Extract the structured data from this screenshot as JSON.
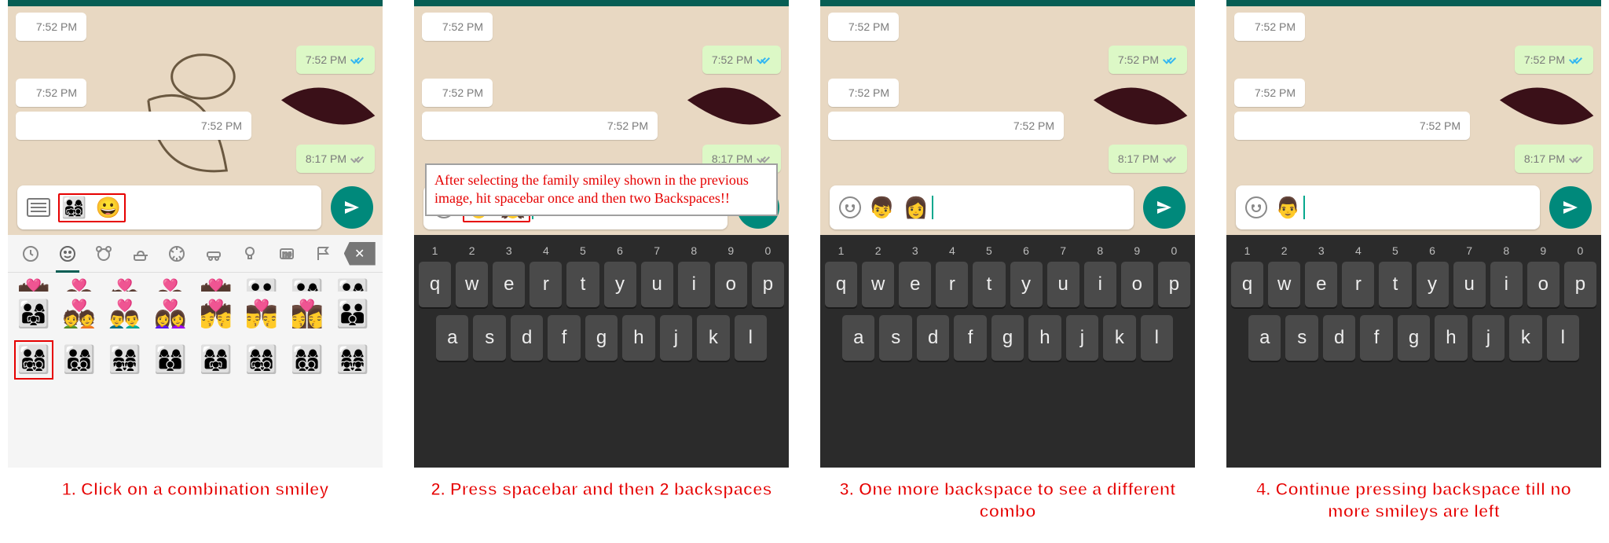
{
  "messages": {
    "t1": "7:52 PM",
    "t2": "7:52 PM",
    "t3": "7:52 PM",
    "t4": "7:52 PM",
    "t5": "8:17 PM"
  },
  "input": {
    "p1_emoji": "👨‍👩‍👧‍👦 😀",
    "p2_emoji": "👦 👧",
    "p3_emoji": "👦 👩",
    "p4_emoji": "👨"
  },
  "annotation": {
    "p2_overlay": "After selecting the family smiley shown in the previous image, hit spacebar once and then two Backspaces!!"
  },
  "emoji_picker": {
    "categories": [
      "recent",
      "smiley",
      "bear",
      "cup",
      "ball",
      "car",
      "bulb",
      "sym",
      "flag",
      "backspace"
    ],
    "row2": [
      "👨‍👩‍👧",
      "💑",
      "👨‍❤️‍👨",
      "👩‍❤️‍👩",
      "💏",
      "👨‍❤️‍💋‍👨",
      "👩‍❤️‍💋‍👩",
      "👪"
    ],
    "row3": [
      "👨‍👩‍👧‍👦",
      "👨‍👩‍👦‍👦",
      "👨‍👩‍👧‍👧",
      "👩‍👩‍👦",
      "👩‍👩‍👧",
      "👩‍👩‍👧‍👦",
      "👩‍👩‍👦‍👦",
      "👩‍👩‍👧‍👧"
    ]
  },
  "keyboard": {
    "nums": [
      "1",
      "2",
      "3",
      "4",
      "5",
      "6",
      "7",
      "8",
      "9",
      "0"
    ],
    "row1": [
      "q",
      "w",
      "e",
      "r",
      "t",
      "y",
      "u",
      "i",
      "o",
      "p"
    ],
    "row2": [
      "a",
      "s",
      "d",
      "f",
      "g",
      "h",
      "j",
      "k",
      "l"
    ]
  },
  "captions": {
    "c1": "1. Click on a combination smiley",
    "c2": "2. Press spacebar and then 2 backspaces",
    "c3": "3. One more backspace to see a different combo",
    "c4": "4. Continue pressing backspace till no more smileys are left"
  }
}
